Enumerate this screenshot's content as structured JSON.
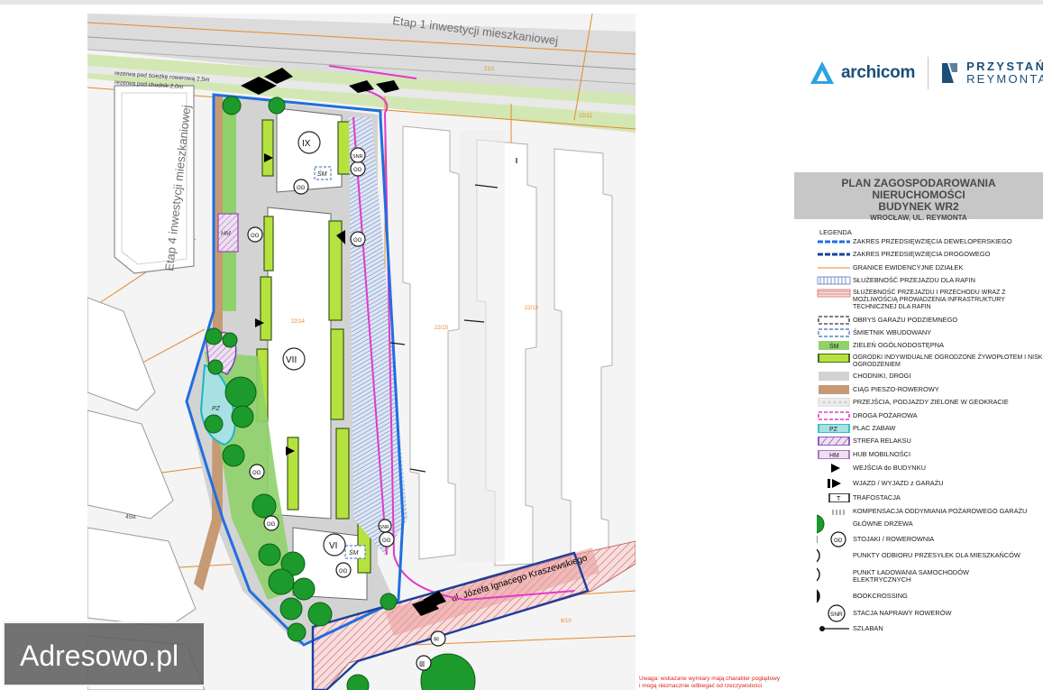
{
  "map": {
    "label_etap1": "Etap 1 inwestycji mieszkaniowej",
    "label_etap4": "Etap 4 inwestycji mieszkaniowej",
    "street": "ul. Józefa Ignacego Kraszewskiego",
    "building_ix": "IX",
    "building_vii": "VII",
    "building_vi": "VI",
    "parcel_a": "22/14",
    "parcel_b": "22/15",
    "parcel_c": "22/13",
    "parcel_d": "21/1",
    "parcel_e": "22/12",
    "parcel_f": "49a",
    "parcel_g": "8/10",
    "reserve_1": "rezerwa pod ścieżkę rowerową 2,5m",
    "reserve_2": "rezerwa pod chodnik 2,0m",
    "pz": "PZ",
    "hm": "HM",
    "sm": "ŚM",
    "snr": "SNR"
  },
  "brand": {
    "archicom": "archicom",
    "przystan": "PRZYSTAŃ",
    "reymonta": "REYMONTA"
  },
  "title": {
    "line1": "PLAN ZAGOSPODAROWANIA NIERUCHOMOŚCI",
    "line2": "BUDYNEK WR2",
    "line3": "WROCŁAW, UL. REYMONTA"
  },
  "legend": {
    "heading": "LEGENDA",
    "items": [
      "ZAKRES PRZEDSIĘWZIĘCIA DEWELOPERSKIEGO",
      "ZAKRES PRZEDSIĘWZIĘCIA DROGOWEGO",
      "GRANICE EWIDENCYJNE DZIAŁEK",
      "SŁUŻEBNOŚĆ PRZEJAZDU DLA RAFIN",
      "SŁUŻEBNOŚĆ PRZEJAZDU I PRZECHODU WRAZ Z MOŻLIWOŚCIĄ PROWADZENIA INFRASTRUKTURY TECHNICZNEJ DLA RAFIN",
      "OBRYS GARAŻU PODZIEMNEGO",
      "ŚMIETNIK WBUDOWANY",
      "ZIELEŃ OGÓLNODOSTĘPNA",
      "OGRÓDKI INDYWIDUALNE OGRODZONE ŻYWOPŁOTEM I NISKIM OGRODZENIEM",
      "CHODNIKI, DROGI",
      "CIĄG PIESZO-ROWEROWY",
      "PRZEJŚCIA, PODJAZDY ZIELONE W GEOKRACIE",
      "DROGA POŻAROWA",
      "PLAC ZABAW",
      "STREFA RELAKSU",
      "HUB MOBILNOŚCI",
      "WEJŚCIA do BUDYNKU",
      "WJAZD / WYJAZD z GARAŻU",
      "TRAFOSTACJA",
      "KOMPENSACJA ODDYMIANIA POŻAROWEGO GARAŻU",
      "GŁÓWNE DRZEWA",
      "STOJAKI / ROWEROWNIA",
      "PUNKTY ODBIORU PRZESYŁEK DLA MIESZKAŃCÓW",
      "PUNKT ŁADOWANIA SAMOCHODÓW ELEKTRYCZNYCH",
      "BOOKCROSSING",
      "STACJA NAPRAWY ROWERÓW",
      "SZLABAN"
    ],
    "sym_sm": "ŚM",
    "sym_pz": "PZ",
    "sym_hm": "HM",
    "sym_t": "T",
    "sym_snr": "SNR"
  },
  "note": {
    "line1": "Uwaga: wskazane wymiary mają charakter poglądowy",
    "line2": "i mogą nieznacznie odbiegać od rzeczywistości"
  },
  "watermark": "Adresowo.pl",
  "colors": {
    "green_private": "#b6e23f",
    "green_public": "#8fd16a",
    "tree": "#1c9a2b",
    "developer_boundary": "#1f6fe0",
    "road_boundary": "#1d3f9a",
    "fire_road": "#e03cc8",
    "parcel_lines": "#e38a2c",
    "sidewalk": "#d3d3d3",
    "bike_path": "#c69a74"
  }
}
